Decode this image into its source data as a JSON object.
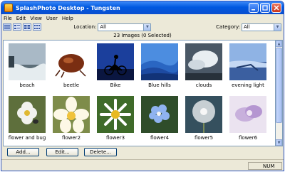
{
  "window": {
    "title": "SplashPhoto Desktop - Tungsten"
  },
  "menu": [
    "File",
    "Edit",
    "View",
    "User",
    "Help"
  ],
  "toolbar": {
    "location_label": "Location:",
    "location_value": "All",
    "category_label": "Category:",
    "category_value": "All"
  },
  "status": {
    "count_text": "23 Images (0 Selected)"
  },
  "gallery": {
    "items": [
      {
        "label": "beach",
        "icon": "beach-photo"
      },
      {
        "label": "beetle",
        "icon": "beetle-photo"
      },
      {
        "label": "Bike",
        "icon": "bike-photo"
      },
      {
        "label": "Blue hills",
        "icon": "blue-hills-photo"
      },
      {
        "label": "clouds",
        "icon": "clouds-photo"
      },
      {
        "label": "evening light",
        "icon": "evening-light-photo"
      },
      {
        "label": "flower and bug",
        "icon": "flower-and-bug-photo"
      },
      {
        "label": "flower2",
        "icon": "flower2-photo"
      },
      {
        "label": "flower3",
        "icon": "flower3-photo"
      },
      {
        "label": "flower4",
        "icon": "flower4-photo"
      },
      {
        "label": "flower5",
        "icon": "flower5-photo"
      },
      {
        "label": "flower6",
        "icon": "flower6-photo"
      }
    ]
  },
  "buttons": {
    "add": "Add...",
    "edit": "Edit...",
    "delete": "Delete..."
  },
  "statusbar": {
    "num": "NUM"
  }
}
